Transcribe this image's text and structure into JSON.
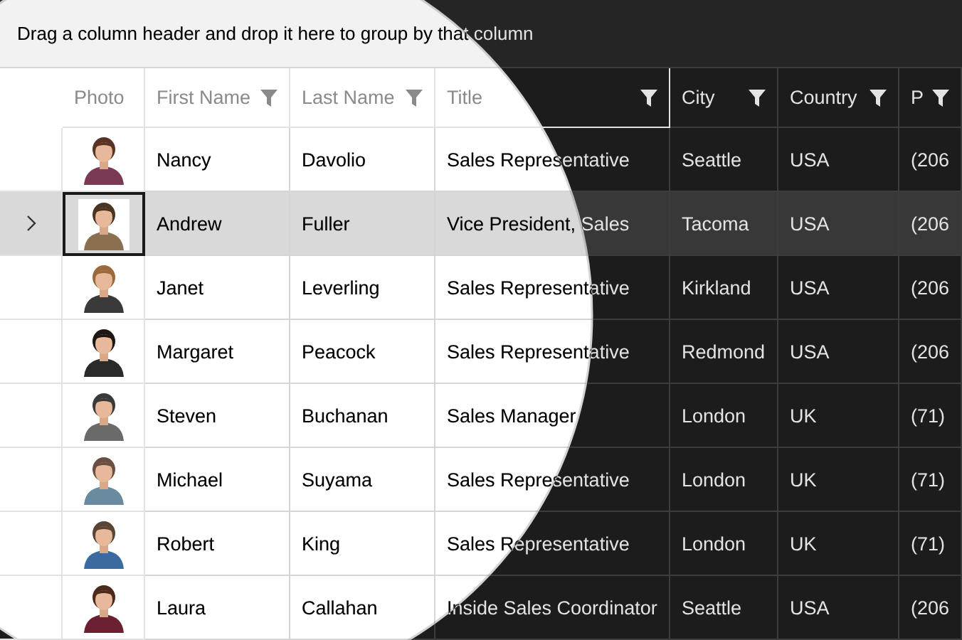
{
  "group_panel": {
    "hint": "Drag a column header and drop it here to group by that column"
  },
  "columns": [
    {
      "label": "Photo",
      "filter": false
    },
    {
      "label": "First Name",
      "filter": true
    },
    {
      "label": "Last Name",
      "filter": true
    },
    {
      "label": "Title",
      "filter": true
    },
    {
      "label": "City",
      "filter": true
    },
    {
      "label": "Country",
      "filter": true
    },
    {
      "label": "P",
      "filter": true
    }
  ],
  "rows": [
    {
      "selected": false,
      "cells": [
        "Nancy",
        "Davolio",
        "Sales Representative",
        "Seattle",
        "USA",
        "(206"
      ]
    },
    {
      "selected": true,
      "cells": [
        "Andrew",
        "Fuller",
        "Vice President, Sales",
        "Tacoma",
        "USA",
        "(206"
      ]
    },
    {
      "selected": false,
      "cells": [
        "Janet",
        "Leverling",
        "Sales Representative",
        "Kirkland",
        "USA",
        "(206"
      ]
    },
    {
      "selected": false,
      "cells": [
        "Margaret",
        "Peacock",
        "Sales Representative",
        "Redmond",
        "USA",
        "(206"
      ]
    },
    {
      "selected": false,
      "cells": [
        "Steven",
        "Buchanan",
        "Sales Manager",
        "London",
        "UK",
        "(71)"
      ]
    },
    {
      "selected": false,
      "cells": [
        "Michael",
        "Suyama",
        "Sales Representative",
        "London",
        "UK",
        "(71)"
      ]
    },
    {
      "selected": false,
      "cells": [
        "Robert",
        "King",
        "Sales Representative",
        "London",
        "UK",
        "(71)"
      ]
    },
    {
      "selected": false,
      "cells": [
        "Laura",
        "Callahan",
        "Inside Sales Coordinator",
        "Seattle",
        "USA",
        "(206"
      ]
    }
  ]
}
